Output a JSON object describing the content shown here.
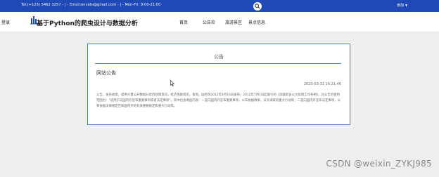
{
  "topbar": {
    "info": "Tel:(+123) 5462 3257 - | - Email:envato@gmail.com - | - Mon-Fri: 9:00-21:00",
    "user_label": "添加"
  },
  "header": {
    "login_label": "登录",
    "site_title": "基于Python的爬虫设计与数据分析",
    "nav": [
      "首页",
      "公告栏",
      "旅游景区",
      "景点信息"
    ]
  },
  "announcement": {
    "panel_title": "公告",
    "subtitle": "网站公告",
    "date": "2023-03-31 16:21:46",
    "body": "公告。发布政策，提供大量公开数据分享的政策资讯，经济金融资讯，查询。国务院2012年4月16日发布，2012年7月1日起施行的《高级职员公文处理工作条例》，对公告的使用范围为：“适用于向国内外宣布重要事项或者法定事项”。其中包含两层内容：一是向国内外宣布重要事项，公布依据政策，法令采取的重大行动等；二是向国内外宣布法定事项，公布依据法律规定告知国内外的有关重要规定和重大行动等。"
  },
  "watermark": "CSDN @weixin_ZYKJ985",
  "colors": {
    "topbar": "#1f49b6",
    "panel_border": "#4a7fb5",
    "background": "#eeeeee"
  }
}
